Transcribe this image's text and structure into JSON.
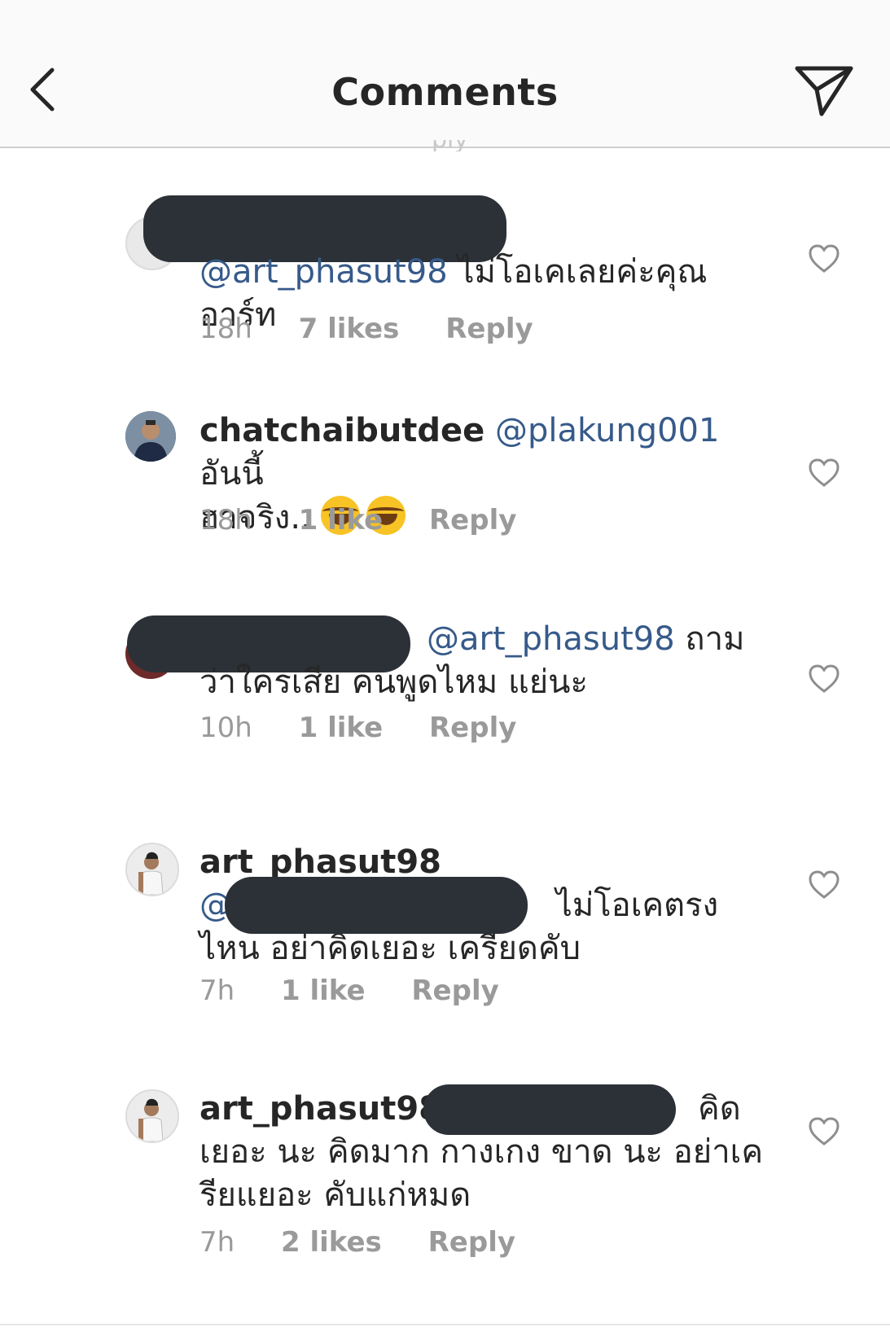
{
  "header": {
    "title": "Comments"
  },
  "comments": [
    {
      "username": "",
      "mention": "@art_phasut98",
      "text": " ไม่โอเคเลยค่ะคุณอาร์ท",
      "time": "18h",
      "likes": "7 likes",
      "reply": "Reply"
    },
    {
      "username": "chatchaibutdee",
      "mention": "@plakung001",
      "text_line1": " อันนี้",
      "text_line2": "ฮาจริง..",
      "time": "18h",
      "likes": "1 like",
      "reply": "Reply"
    },
    {
      "username": "",
      "mention": "@art_phasut98",
      "text_line1": " ถาม",
      "text_line2": "ว่าใครเสีย คนพูดไหม แย่นะ",
      "time": "10h",
      "likes": "1 like",
      "reply": "Reply"
    },
    {
      "username": "art_phasut98",
      "mention": "@",
      "text_line1": " ไม่โอเคตรง",
      "text_line2": "ไหน อย่าคิดเยอะ เครียดคับ",
      "time": "7h",
      "likes": "1 like",
      "reply": "Reply"
    },
    {
      "username": "art_phasut98",
      "text_line1": "คิด",
      "text_line2": "เยอะ นะ คิดมาก กางเกง ขาด นะ อย่าเค",
      "text_line3": "รียแยอะ คับแก่หมด",
      "time": "7h",
      "likes": "2 likes",
      "reply": "Reply"
    }
  ],
  "colors": {
    "mention": "#365a8a",
    "meta": "#9a9a9a",
    "redaction": "#2b3137"
  },
  "icons": [
    "back-chevron-icon",
    "direct-send-icon",
    "heart-outline-icon",
    "laughing-emoji-icon"
  ]
}
